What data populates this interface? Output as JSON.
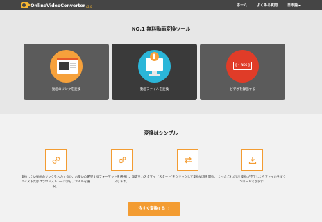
{
  "header": {
    "logo_text": "OnlineVideoConverter",
    "logo_version": "v2.0",
    "nav": {
      "home": "ホーム",
      "faq": "よくある質問",
      "lang": "日本語"
    }
  },
  "hero": {
    "title": "NO.1 無料動画変換ツール",
    "cards": [
      {
        "label": "動画のリンクを変換",
        "icon": "link-convert-icon",
        "color": "#f6a13b"
      },
      {
        "label": "動画ファイルを変換",
        "icon": "upload-file-icon",
        "color": "#2bb6d9"
      },
      {
        "label": "ビデオを録画する",
        "icon": "record-icon",
        "rec_text": "[ • REC ]",
        "color": "#e03c28"
      }
    ]
  },
  "steps": {
    "title": "変換はシンプル",
    "items": [
      {
        "icon": "link-icon",
        "text": "変換したい動画のリンクを入力するか、お使いのデバイスまたはクラウドストレージからファイルを選択。"
      },
      {
        "icon": "settings-icon",
        "text": "希望するフォーマットを選択し、設定をカスタマイズします。"
      },
      {
        "icon": "convert-arrows-icon",
        "text": "\"スタート\"をクリックして変換処理を開始。"
      },
      {
        "icon": "download-icon",
        "text": "たったこれだけ! 変換が完了したらファイルをダウンロードできます!"
      }
    ]
  },
  "cta": {
    "label": "今すぐ変換する",
    "arrow": "›"
  },
  "colors": {
    "accent": "#f39c32",
    "header_bg": "#454545"
  }
}
